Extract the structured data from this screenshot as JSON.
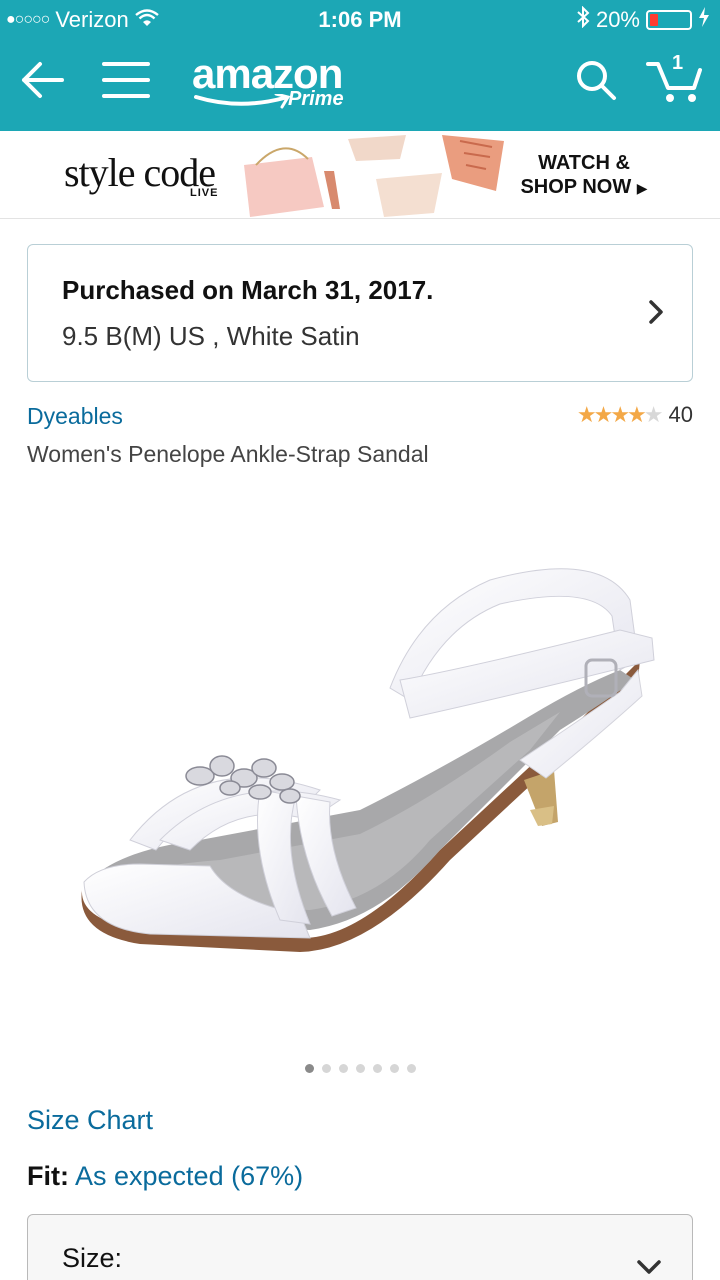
{
  "status_bar": {
    "signal": "●○○○○",
    "carrier": "Verizon",
    "time": "1:06 PM",
    "battery_percent": "20%",
    "battery_level": 0.2
  },
  "nav": {
    "logo_text": "amazon",
    "logo_subtext": "Prime",
    "cart_count": "1"
  },
  "banner": {
    "brand": "style code",
    "brand_badge": "LIVE",
    "cta_line1": "WATCH &",
    "cta_line2": "SHOP NOW"
  },
  "purchase": {
    "title": "Purchased on March 31, 2017.",
    "details": "9.5 B(M) US , White Satin"
  },
  "product": {
    "brand": "Dyeables",
    "title": "Women's Penelope Ankle-Strap Sandal",
    "rating_stars": 4,
    "rating_count": "40",
    "image_count": 7,
    "active_image_index": 0
  },
  "links": {
    "size_chart": "Size Chart"
  },
  "fit": {
    "label": "Fit:",
    "value": "As expected (67%)"
  },
  "size": {
    "label": "Size:"
  },
  "colors": {
    "brand_teal": "#1ca7b5",
    "link_blue": "#0a6b9c",
    "star_orange": "#f3a847"
  }
}
